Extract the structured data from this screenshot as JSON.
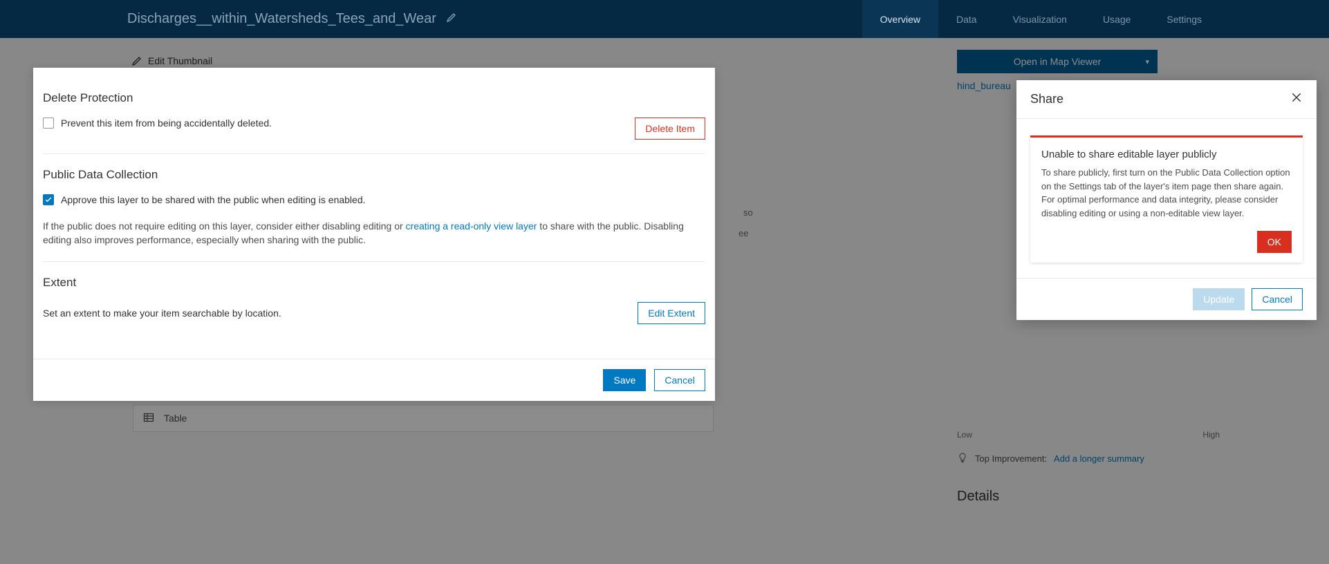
{
  "header": {
    "title": "Discharges__within_Watersheds_Tees_and_Wear",
    "tabs": [
      "Overview",
      "Data",
      "Visualization",
      "Usage",
      "Settings"
    ],
    "active_tab": "Overview"
  },
  "page": {
    "edit_thumbnail": "Edit Thumbnail",
    "open_map_viewer": "Open in Map Viewer",
    "owner": "hind_bureau",
    "low": "Low",
    "high": "High",
    "top_improvement_label": "Top Improvement:",
    "top_improvement_link": "Add a longer summary",
    "details": "Details",
    "table_label": "Table",
    "faint1": "so",
    "faint2": "ee"
  },
  "settings": {
    "delete_protection": {
      "title": "Delete Protection",
      "checkbox_label": "Prevent this item from being accidentally deleted.",
      "checked": false,
      "delete_button": "Delete Item"
    },
    "public_data": {
      "title": "Public Data Collection",
      "checkbox_label": "Approve this layer to be shared with the public when editing is enabled.",
      "checked": true,
      "help_pre": "If the public does not require editing on this layer, consider either disabling editing or ",
      "help_link": "creating a read-only view layer",
      "help_post": " to share with the public. Disabling editing also improves performance, especially when sharing with the public."
    },
    "extent": {
      "title": "Extent",
      "desc": "Set an extent to make your item searchable by location.",
      "button": "Edit Extent"
    },
    "footer": {
      "save": "Save",
      "cancel": "Cancel"
    }
  },
  "share": {
    "title": "Share",
    "alert": {
      "title": "Unable to share editable layer publicly",
      "body": "To share publicly, first turn on the Public Data Collection option on the Settings tab of the layer's item page then share again. For optimal performance and data integrity, please consider disabling editing or using a non-editable view layer.",
      "ok": "OK"
    },
    "footer": {
      "update": "Update",
      "cancel": "Cancel"
    }
  }
}
